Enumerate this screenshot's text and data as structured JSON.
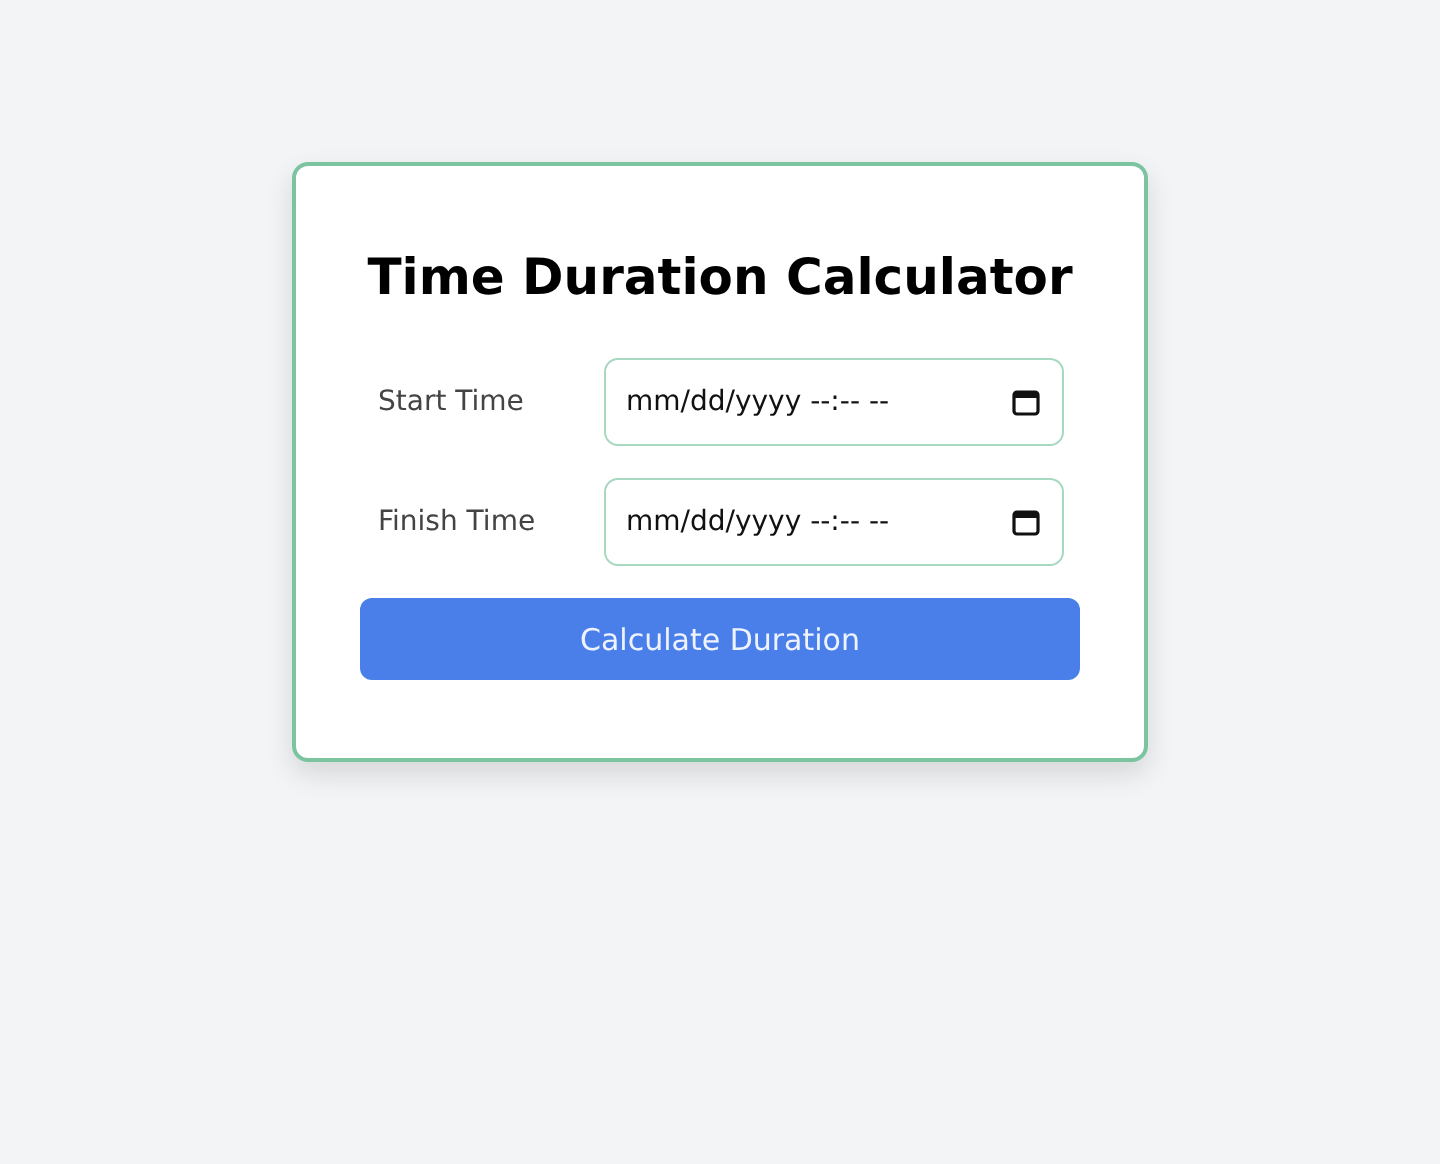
{
  "title": "Time Duration Calculator",
  "fields": [
    {
      "label": "Start Time",
      "placeholder": "mm/dd/yyyy --:-- --"
    },
    {
      "label": "Finish Time",
      "placeholder": "mm/dd/yyyy --:-- --"
    }
  ],
  "button": "Calculate Duration"
}
